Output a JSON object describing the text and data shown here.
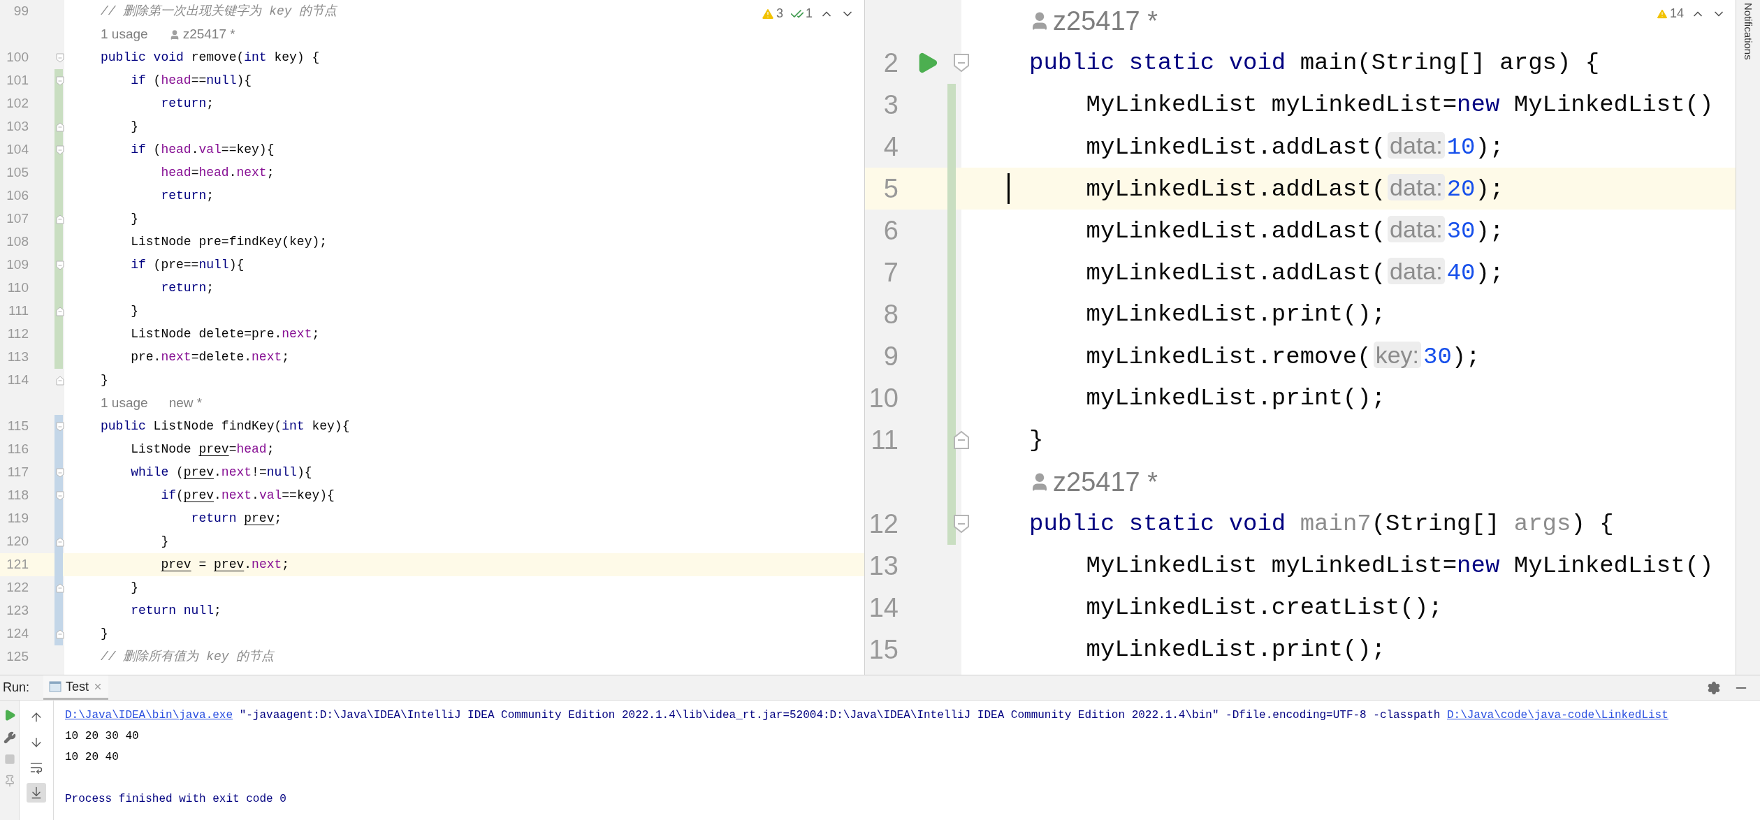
{
  "left_editor": {
    "inspections": [
      {
        "kind": "warning",
        "count": "3"
      },
      {
        "kind": "ok",
        "count": "1"
      }
    ],
    "rows": [
      {
        "kind": "code",
        "number": "99",
        "tokens": [
          {
            "kind": "comment",
            "text": "// 删除第一次出现关键字为 key 的节点"
          }
        ]
      },
      {
        "kind": "lens",
        "usage": "1 usage",
        "author": "z25417 *",
        "author_icon": true
      },
      {
        "kind": "code",
        "number": "100",
        "fold_start": true,
        "tokens": [
          {
            "kind": "kw",
            "text": "public void "
          },
          {
            "kind": "p",
            "text": "remove("
          },
          {
            "kind": "kw",
            "text": "int"
          },
          {
            "kind": "p",
            "text": " key) {"
          }
        ]
      },
      {
        "kind": "code",
        "number": "101",
        "fold_start": true,
        "added": true,
        "tokens": [
          {
            "kind": "kw",
            "text": "    if"
          },
          {
            "kind": "p",
            "text": " ("
          },
          {
            "kind": "field",
            "text": "head"
          },
          {
            "kind": "p",
            "text": "=="
          },
          {
            "kind": "kw",
            "text": "null"
          },
          {
            "kind": "p",
            "text": "){"
          }
        ]
      },
      {
        "kind": "code",
        "number": "102",
        "added": true,
        "tokens": [
          {
            "kind": "kw",
            "text": "        return"
          },
          {
            "kind": "p",
            "text": ";"
          }
        ]
      },
      {
        "kind": "code",
        "number": "103",
        "fold_end": true,
        "added": true,
        "tokens": [
          {
            "kind": "p",
            "text": "    }"
          }
        ]
      },
      {
        "kind": "code",
        "number": "104",
        "fold_start": true,
        "added": true,
        "tokens": [
          {
            "kind": "kw",
            "text": "    if"
          },
          {
            "kind": "p",
            "text": " ("
          },
          {
            "kind": "field",
            "text": "head"
          },
          {
            "kind": "p",
            "text": "."
          },
          {
            "kind": "field",
            "text": "val"
          },
          {
            "kind": "p",
            "text": "==key){"
          }
        ]
      },
      {
        "kind": "code",
        "number": "105",
        "added": true,
        "tokens": [
          {
            "kind": "field",
            "text": "        head"
          },
          {
            "kind": "p",
            "text": "="
          },
          {
            "kind": "field",
            "text": "head"
          },
          {
            "kind": "p",
            "text": "."
          },
          {
            "kind": "field",
            "text": "next"
          },
          {
            "kind": "p",
            "text": ";"
          }
        ]
      },
      {
        "kind": "code",
        "number": "106",
        "added": true,
        "tokens": [
          {
            "kind": "kw",
            "text": "        return"
          },
          {
            "kind": "p",
            "text": ";"
          }
        ]
      },
      {
        "kind": "code",
        "number": "107",
        "fold_end": true,
        "added": true,
        "tokens": [
          {
            "kind": "p",
            "text": "    }"
          }
        ]
      },
      {
        "kind": "code",
        "number": "108",
        "added": true,
        "tokens": [
          {
            "kind": "p",
            "text": "    ListNode pre=findKey(key);"
          }
        ]
      },
      {
        "kind": "code",
        "number": "109",
        "fold_start": true,
        "added": true,
        "tokens": [
          {
            "kind": "kw",
            "text": "    if"
          },
          {
            "kind": "p",
            "text": " (pre=="
          },
          {
            "kind": "kw",
            "text": "null"
          },
          {
            "kind": "p",
            "text": "){"
          }
        ]
      },
      {
        "kind": "code",
        "number": "110",
        "added": true,
        "tokens": [
          {
            "kind": "kw",
            "text": "        return"
          },
          {
            "kind": "p",
            "text": ";"
          }
        ]
      },
      {
        "kind": "code",
        "number": "111",
        "fold_end": true,
        "added": true,
        "tokens": [
          {
            "kind": "p",
            "text": "    }"
          }
        ]
      },
      {
        "kind": "code",
        "number": "112",
        "added": true,
        "tokens": [
          {
            "kind": "p",
            "text": "    ListNode delete=pre."
          },
          {
            "kind": "field",
            "text": "next"
          },
          {
            "kind": "p",
            "text": ";"
          }
        ]
      },
      {
        "kind": "code",
        "number": "113",
        "added": true,
        "tokens": [
          {
            "kind": "p",
            "text": "    pre."
          },
          {
            "kind": "field",
            "text": "next"
          },
          {
            "kind": "p",
            "text": "=delete."
          },
          {
            "kind": "field",
            "text": "next"
          },
          {
            "kind": "p",
            "text": ";"
          }
        ]
      },
      {
        "kind": "code",
        "number": "114",
        "fold_end": true,
        "tokens": [
          {
            "kind": "p",
            "text": "}"
          }
        ]
      },
      {
        "kind": "lens",
        "usage": "1 usage",
        "author": "new *"
      },
      {
        "kind": "code",
        "number": "115",
        "fold_start": true,
        "modified": true,
        "tokens": [
          {
            "kind": "kw",
            "text": "public"
          },
          {
            "kind": "p",
            "text": " ListNode findKey("
          },
          {
            "kind": "kw",
            "text": "int"
          },
          {
            "kind": "p",
            "text": " key){"
          }
        ]
      },
      {
        "kind": "code",
        "number": "116",
        "modified": true,
        "tokens": [
          {
            "kind": "p",
            "text": "    ListNode "
          },
          {
            "kind": "var",
            "text": "prev"
          },
          {
            "kind": "p",
            "text": "="
          },
          {
            "kind": "field",
            "text": "head"
          },
          {
            "kind": "p",
            "text": ";"
          }
        ]
      },
      {
        "kind": "code",
        "number": "117",
        "fold_start": true,
        "modified": true,
        "tokens": [
          {
            "kind": "kw",
            "text": "    while"
          },
          {
            "kind": "p",
            "text": " ("
          },
          {
            "kind": "var",
            "text": "prev"
          },
          {
            "kind": "p",
            "text": "."
          },
          {
            "kind": "field",
            "text": "next"
          },
          {
            "kind": "p",
            "text": "!="
          },
          {
            "kind": "kw",
            "text": "null"
          },
          {
            "kind": "p",
            "text": "){"
          }
        ]
      },
      {
        "kind": "code",
        "number": "118",
        "fold_start": true,
        "modified": true,
        "tokens": [
          {
            "kind": "kw",
            "text": "        if"
          },
          {
            "kind": "p",
            "text": "("
          },
          {
            "kind": "var",
            "text": "prev"
          },
          {
            "kind": "p",
            "text": "."
          },
          {
            "kind": "field",
            "text": "next"
          },
          {
            "kind": "p",
            "text": "."
          },
          {
            "kind": "field",
            "text": "val"
          },
          {
            "kind": "p",
            "text": "==key){"
          }
        ]
      },
      {
        "kind": "code",
        "number": "119",
        "modified": true,
        "tokens": [
          {
            "kind": "kw",
            "text": "            return "
          },
          {
            "kind": "var",
            "text": "prev"
          },
          {
            "kind": "p",
            "text": ";"
          }
        ]
      },
      {
        "kind": "code",
        "number": "120",
        "fold_end": true,
        "modified": true,
        "tokens": [
          {
            "kind": "p",
            "text": "        }"
          }
        ]
      },
      {
        "kind": "code",
        "number": "121",
        "modified": true,
        "current": true,
        "tokens": [
          {
            "kind": "var",
            "text": "        prev"
          },
          {
            "kind": "p",
            "text": " = "
          },
          {
            "kind": "var",
            "text": "prev"
          },
          {
            "kind": "p",
            "text": "."
          },
          {
            "kind": "field",
            "text": "next"
          },
          {
            "kind": "p",
            "text": ";"
          }
        ]
      },
      {
        "kind": "code",
        "number": "122",
        "fold_end": true,
        "modified": true,
        "tokens": [
          {
            "kind": "p",
            "text": "    }"
          }
        ]
      },
      {
        "kind": "code",
        "number": "123",
        "modified": true,
        "tokens": [
          {
            "kind": "kw",
            "text": "    return null"
          },
          {
            "kind": "p",
            "text": ";"
          }
        ]
      },
      {
        "kind": "code",
        "number": "124",
        "fold_end": true,
        "modified": true,
        "tokens": [
          {
            "kind": "p",
            "text": "}"
          }
        ]
      },
      {
        "kind": "code",
        "number": "125",
        "tokens": [
          {
            "kind": "comment",
            "text": "// 删除所有值为 key 的节点"
          }
        ]
      }
    ]
  },
  "right_editor": {
    "inspections": [
      {
        "kind": "warning",
        "count": "14"
      }
    ],
    "rows": [
      {
        "kind": "lens",
        "author": "z25417 *",
        "author_icon": true
      },
      {
        "kind": "code",
        "number": "2",
        "fold_start": true,
        "run": true,
        "tokens": [
          {
            "kind": "kw",
            "text": "public static void "
          },
          {
            "kind": "p",
            "text": "main(String[] args) {"
          }
        ]
      },
      {
        "kind": "code",
        "number": "3",
        "added": true,
        "tokens": [
          {
            "kind": "p",
            "text": "    MyLinkedList myLinkedList="
          },
          {
            "kind": "kw",
            "text": "new"
          },
          {
            "kind": "p",
            "text": " MyLinkedList()"
          }
        ]
      },
      {
        "kind": "code",
        "number": "4",
        "added": true,
        "tokens": [
          {
            "kind": "p",
            "text": "    myLinkedList.addLast("
          },
          {
            "kind": "hint",
            "text": "data:"
          },
          {
            "kind": "num",
            "text": "10"
          },
          {
            "kind": "p",
            "text": ");"
          }
        ]
      },
      {
        "kind": "code",
        "number": "5",
        "added": true,
        "current": true,
        "tokens": [
          {
            "kind": "p",
            "text": "    myLinkedList.addLast("
          },
          {
            "kind": "hint",
            "text": "data:"
          },
          {
            "kind": "num",
            "text": "20"
          },
          {
            "kind": "p",
            "text": ");"
          }
        ]
      },
      {
        "kind": "code",
        "number": "6",
        "added": true,
        "tokens": [
          {
            "kind": "p",
            "text": "    myLinkedList.addLast("
          },
          {
            "kind": "hint",
            "text": "data:"
          },
          {
            "kind": "num",
            "text": "30"
          },
          {
            "kind": "p",
            "text": ");"
          }
        ]
      },
      {
        "kind": "code",
        "number": "7",
        "added": true,
        "tokens": [
          {
            "kind": "p",
            "text": "    myLinkedList.addLast("
          },
          {
            "kind": "hint",
            "text": "data:"
          },
          {
            "kind": "num",
            "text": "40"
          },
          {
            "kind": "p",
            "text": ");"
          }
        ]
      },
      {
        "kind": "code",
        "number": "8",
        "added": true,
        "tokens": [
          {
            "kind": "p",
            "text": "    myLinkedList.print();"
          }
        ]
      },
      {
        "kind": "code",
        "number": "9",
        "added": true,
        "tokens": [
          {
            "kind": "p",
            "text": "    myLinkedList.remove("
          },
          {
            "kind": "hint",
            "text": "key:"
          },
          {
            "kind": "num",
            "text": "30"
          },
          {
            "kind": "p",
            "text": ");"
          }
        ]
      },
      {
        "kind": "code",
        "number": "10",
        "added": true,
        "tokens": [
          {
            "kind": "p",
            "text": "    myLinkedList.print();"
          }
        ]
      },
      {
        "kind": "code",
        "number": "11",
        "fold_end": true,
        "added": true,
        "tokens": [
          {
            "kind": "p",
            "text": "}"
          }
        ]
      },
      {
        "kind": "lens",
        "author": "z25417 *",
        "author_icon": true,
        "added": true
      },
      {
        "kind": "code",
        "number": "12",
        "fold_start": true,
        "added": true,
        "tokens": [
          {
            "kind": "kw",
            "text": "public static void "
          },
          {
            "kind": "gray",
            "text": "main7"
          },
          {
            "kind": "p",
            "text": "(String[] "
          },
          {
            "kind": "gray",
            "text": "args"
          },
          {
            "kind": "p",
            "text": ") {"
          }
        ]
      },
      {
        "kind": "code",
        "number": "13",
        "tokens": [
          {
            "kind": "p",
            "text": "    MyLinkedList myLinkedList="
          },
          {
            "kind": "kw",
            "text": "new"
          },
          {
            "kind": "p",
            "text": " MyLinkedList()"
          }
        ]
      },
      {
        "kind": "code",
        "number": "14",
        "tokens": [
          {
            "kind": "p",
            "text": "    myLinkedList.creatList();"
          }
        ]
      },
      {
        "kind": "code",
        "number": "15",
        "tokens": [
          {
            "kind": "p",
            "text": "    myLinkedList.print();"
          }
        ]
      }
    ]
  },
  "notifications_label": "Notifications",
  "run_panel": {
    "label": "Run:",
    "tabs": [
      {
        "label": "Test",
        "selected": true
      }
    ],
    "console_toolbar": [
      {
        "kind": "up",
        "selected": false
      },
      {
        "kind": "down",
        "selected": false
      },
      {
        "kind": "wrap",
        "selected": false
      },
      {
        "kind": "scroll-end",
        "selected": true
      }
    ],
    "console": [
      {
        "kind": "command",
        "segments": [
          {
            "kind": "link",
            "text": "D:\\Java\\IDEA\\bin\\java.exe"
          },
          {
            "kind": "plain",
            "text": " \"-javaagent:D:\\Java\\IDEA\\IntelliJ IDEA Community Edition 2022.1.4\\lib\\idea_rt.jar=52004:D:\\Java\\IDEA\\IntelliJ IDEA Community Edition 2022.1.4\\bin\" -Dfile.encoding=UTF-8 -classpath "
          },
          {
            "kind": "link",
            "text": "D:\\Java\\code\\java-code\\LinkedList"
          }
        ]
      },
      {
        "kind": "output",
        "segments": [
          {
            "kind": "plain",
            "text": "10 20 30 40"
          }
        ]
      },
      {
        "kind": "output",
        "segments": [
          {
            "kind": "plain",
            "text": "10 20 40"
          }
        ]
      },
      {
        "kind": "exit",
        "segments": [
          {
            "kind": "plain",
            "text": "Process finished with exit code 0"
          }
        ]
      }
    ]
  }
}
